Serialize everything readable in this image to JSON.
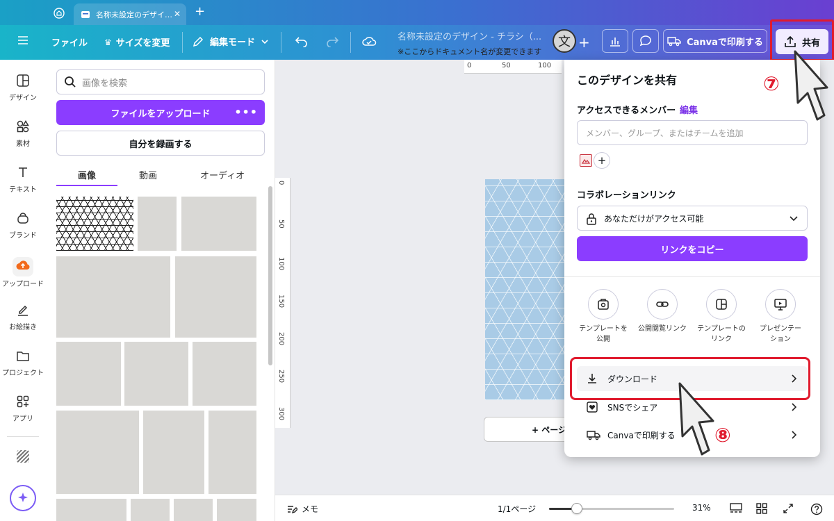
{
  "tabs": {
    "doc_tab_label": "名称未設定のデザイ…",
    "close": "✕",
    "new": "+"
  },
  "toolbar": {
    "file": "ファイル",
    "resize": "サイズを変更",
    "edit_mode": "編集モード",
    "doc_title": "名称未設定のデザイン - チラシ（...",
    "doc_hint": "※ここからドキュメント名が変更できます",
    "translate_glyph": "文",
    "add": "+",
    "print": "Canvaで印刷する",
    "share": "共有"
  },
  "rail": [
    {
      "label": "デザイン",
      "icon": "design-icon"
    },
    {
      "label": "素材",
      "icon": "elements-icon"
    },
    {
      "label": "テキスト",
      "icon": "text-icon"
    },
    {
      "label": "ブランド",
      "icon": "brand-icon"
    },
    {
      "label": "アップロード",
      "icon": "upload-cloud-icon"
    },
    {
      "label": "お絵描き",
      "icon": "draw-icon"
    },
    {
      "label": "プロジェクト",
      "icon": "folder-icon"
    },
    {
      "label": "アプリ",
      "icon": "apps-icon"
    }
  ],
  "panel": {
    "search_placeholder": "画像を検索",
    "upload": "ファイルをアップロード",
    "upload_more": "•••",
    "record": "自分を録画する",
    "tabs": [
      "画像",
      "動画",
      "オーディオ"
    ]
  },
  "canvas": {
    "ruler_top": [
      "0",
      "50",
      "100"
    ],
    "ruler_left": [
      "0",
      "50",
      "100",
      "150",
      "200",
      "250",
      "300"
    ],
    "add_page": "+ ページ"
  },
  "footer": {
    "notes": "メモ",
    "pages": "1/1ページ",
    "zoom": "31%",
    "zoom_level": 0.31
  },
  "share_panel": {
    "title": "このデザインを共有",
    "members_label": "アクセスできるメンバー",
    "edit": "編集",
    "member_placeholder": "メンバー、グループ、またはチームを追加",
    "add": "+",
    "collab_label": "コラボレーションリンク",
    "access": "あなただけがアクセス可能",
    "copy_link": "リンクをコピー",
    "options": [
      {
        "line1": "テンプレートを",
        "line2": "公開"
      },
      {
        "line1": "公開閲覧リンク",
        "line2": ""
      },
      {
        "line1": "テンプレートの",
        "line2": "リンク"
      },
      {
        "line1": "プレゼンテー",
        "line2": "ション"
      }
    ],
    "rows": [
      "ダウンロード",
      "SNSでシェア",
      "Canvaで印刷する"
    ]
  },
  "annotations": {
    "step7": "⑦",
    "step8": "⑧",
    "color": "#e01b2e"
  },
  "colors": {
    "accent": "#8b3dff",
    "highlight": "#e01b2e"
  }
}
